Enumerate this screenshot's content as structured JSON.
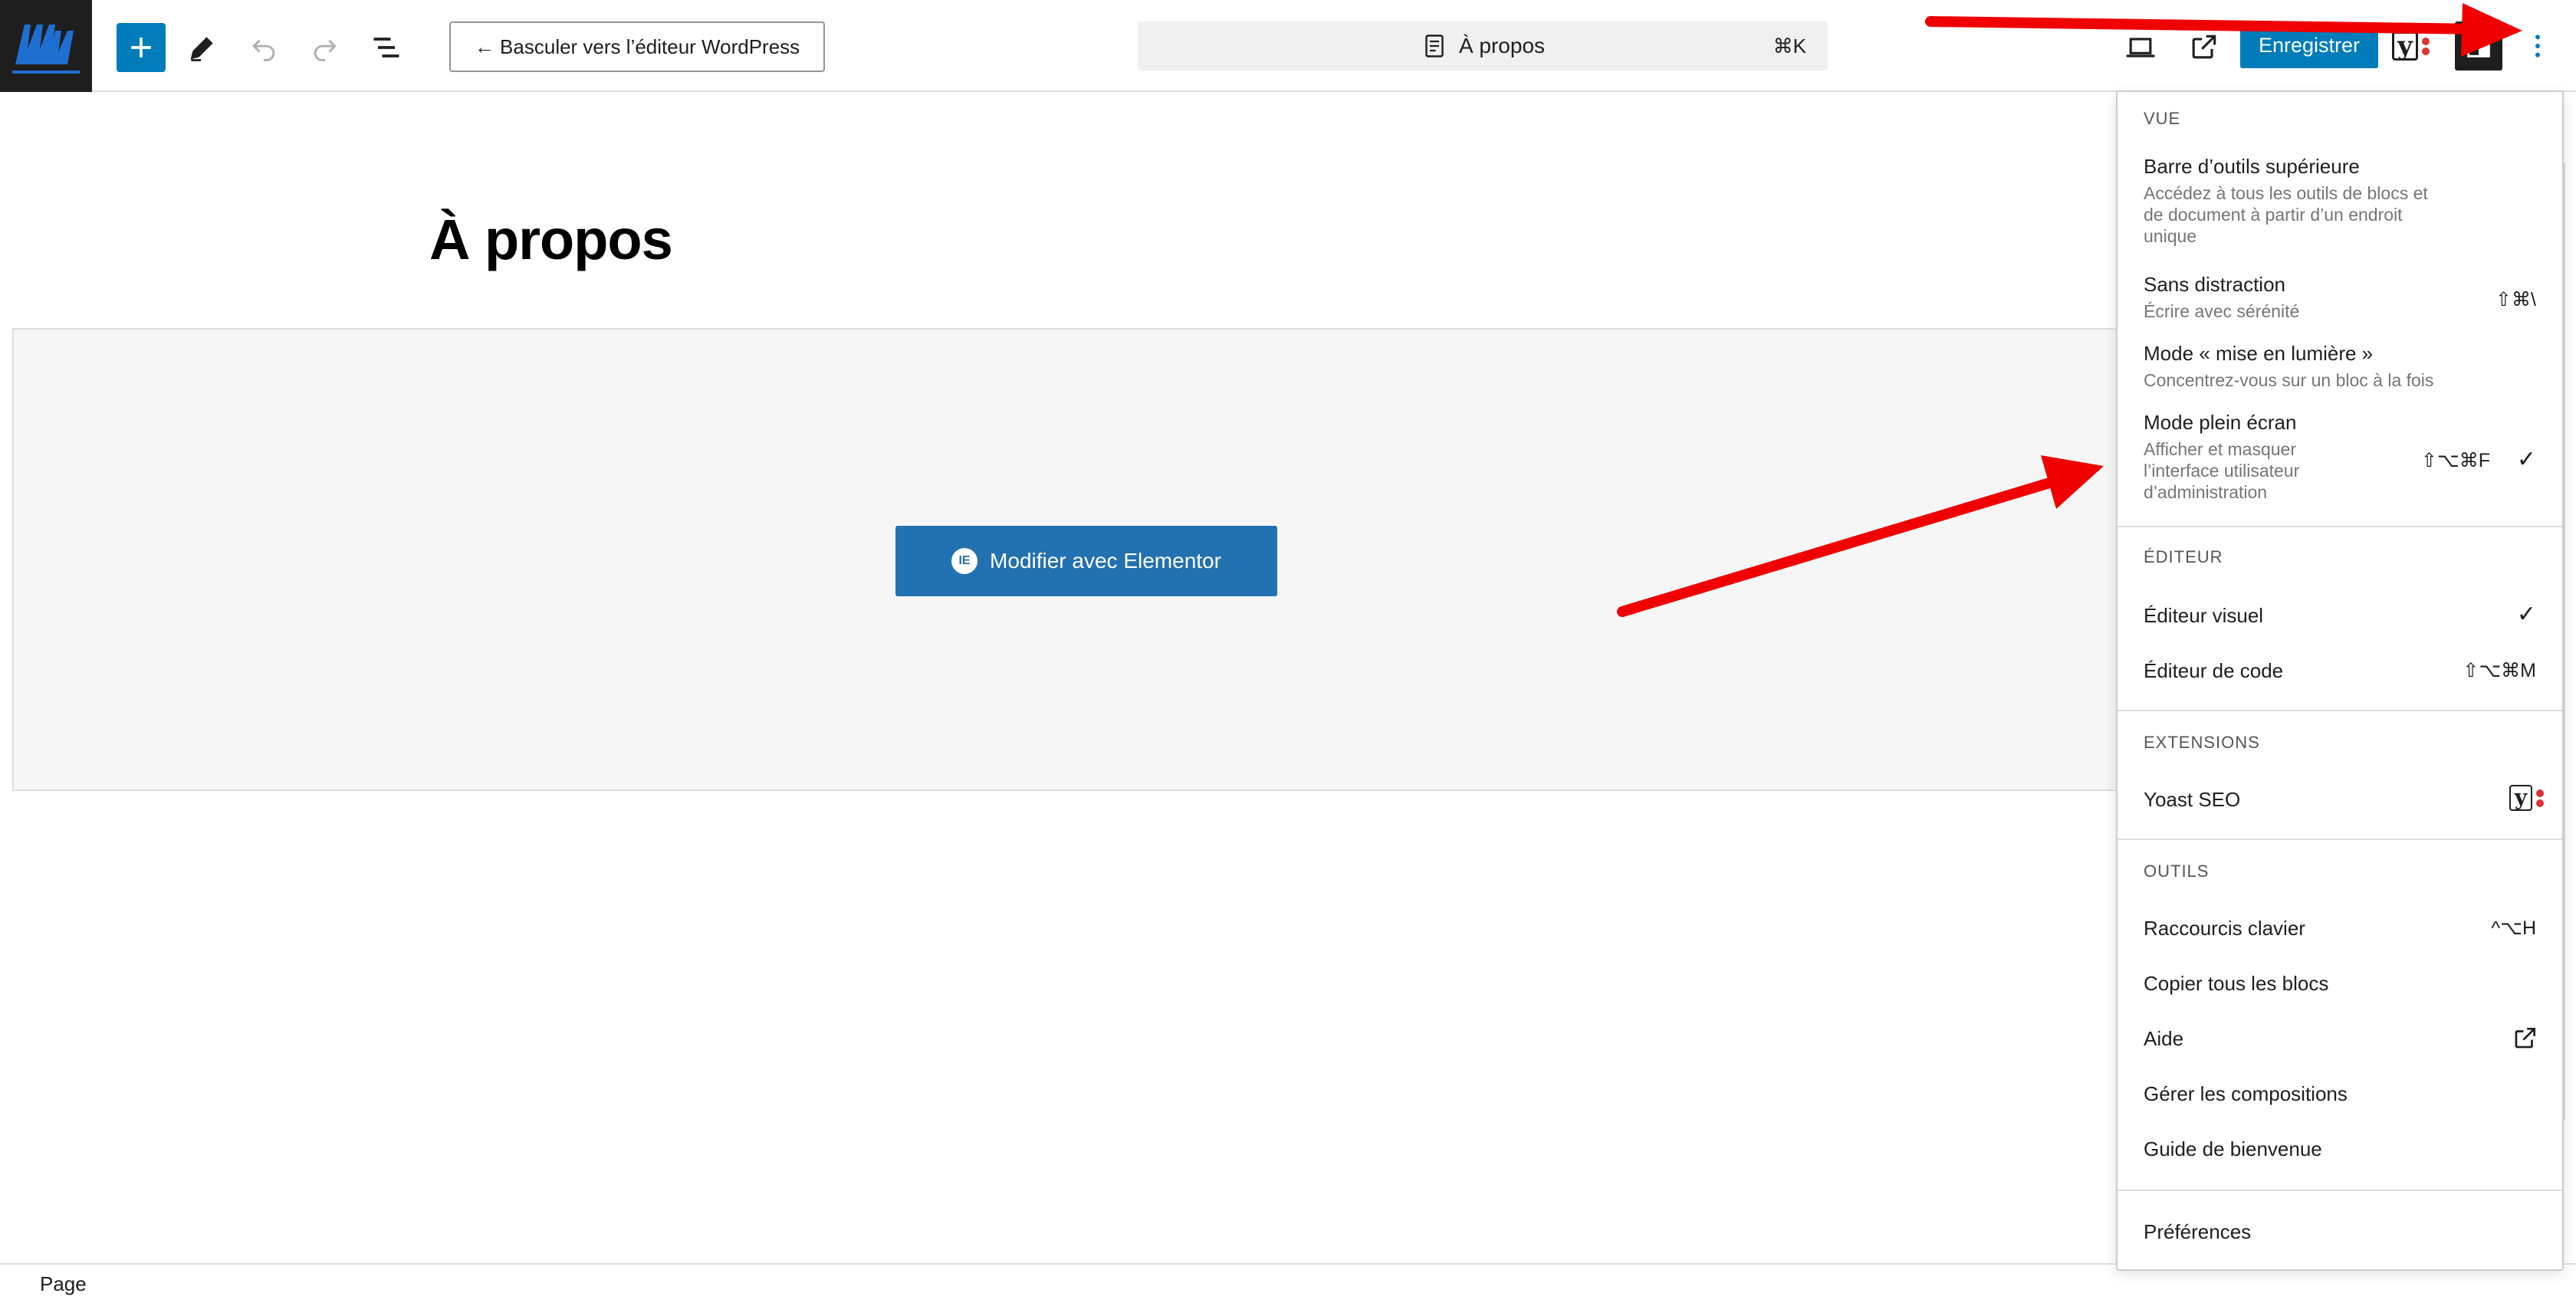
{
  "toolbar": {
    "switch_editor_label": "← Basculer vers l’éditeur WordPress",
    "document_title": "À propos",
    "command_shortcut": "⌘K",
    "save_label": "Enregistrer"
  },
  "post": {
    "title": "À propos",
    "elementor_button_label": "Modifier avec Elementor"
  },
  "footer": {
    "label": "Page"
  },
  "menu": {
    "groups": [
      {
        "title": "VUE",
        "items": [
          {
            "label": "Barre d’outils supérieure",
            "description": [
              "Accédez à tous les outils de blocs et",
              "de document à partir d’un endroit",
              "unique"
            ]
          },
          {
            "label": "Sans distraction",
            "description": [
              "Écrire avec sérénité"
            ],
            "shortcut": "⇧⌘\\"
          },
          {
            "label": "Mode « mise en lumière »",
            "description": [
              "Concentrez-vous sur un bloc à la fois"
            ]
          },
          {
            "label": "Mode plein écran",
            "description": [
              "Afficher et masquer",
              "l’interface utilisateur",
              "d’administration"
            ],
            "shortcut": "⇧⌥⌘F",
            "checked": "✓"
          }
        ]
      },
      {
        "title": "ÉDITEUR",
        "items": [
          {
            "label": "Éditeur visuel",
            "checked": "✓"
          },
          {
            "label": "Éditeur de code",
            "shortcut": "⇧⌥⌘M"
          }
        ]
      },
      {
        "title": "EXTENSIONS",
        "items": [
          {
            "label": "Yoast SEO",
            "icon": "yoast-icon"
          }
        ]
      },
      {
        "title": "OUTILS",
        "items": [
          {
            "label": "Raccourcis clavier",
            "shortcut": "^⌥H"
          },
          {
            "label": "Copier tous les blocs"
          },
          {
            "label": "Aide",
            "icon": "external-link-icon"
          },
          {
            "label": "Gérer les compositions"
          },
          {
            "label": "Guide de bienvenue"
          }
        ]
      },
      {
        "items": [
          {
            "label": "Préférences"
          }
        ]
      }
    ]
  },
  "colors": {
    "primary": "#007cba",
    "elementor": "#2271b1",
    "dark": "#1e1e1e",
    "annotation_arrow": "#f00000",
    "yoast_dot": "#dc3232"
  }
}
